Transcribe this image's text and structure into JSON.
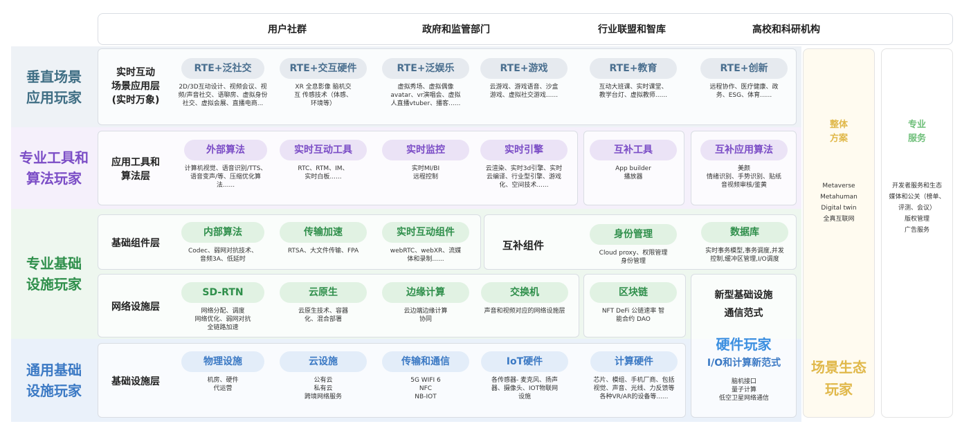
{
  "top_bar": {
    "items": [
      "用户社群",
      "政府和监管部门",
      "行业联盟和智库",
      "高校和科研机构"
    ]
  },
  "bands": [
    {
      "label": "垂直场景\n应用玩家",
      "color": "#3f6e84"
    },
    {
      "label": "专业工具和\n算法玩家",
      "color": "#7b4dc6"
    },
    {
      "label": "专业基础\n设施玩家",
      "color": "#2f8f4b"
    },
    {
      "label": "通用基础\n设施玩家",
      "color": "#3b79c4"
    }
  ],
  "layers": {
    "rte": {
      "label": "实时互动\n场景应用层\n(实时万象)",
      "cards": [
        {
          "title": "RTE+泛社交",
          "desc": "2D/3D互动设计、视频会议、视\n频/声音社交、语聊房、虚拟身份\n社交、虚拟会展、直播电商..."
        },
        {
          "title": "RTE+交互硬件",
          "desc": "XR 全息影像 脑机交\n互 传感技术（体感、\n环境等）"
        },
        {
          "title": "RTE+泛娱乐",
          "desc": "虚拟秀场、虚拟偶像\navatar、vr演唱会、虚拟\n人直播vtuber、播客......"
        },
        {
          "title": "RTE+游戏",
          "desc": "云游戏、游戏语音、沙盒\n游戏、虚拟社交游戏......"
        },
        {
          "title": "RTE+教育",
          "desc": "互动大班课、实时课堂、\n教学台灯、虚拟教师......"
        },
        {
          "title": "RTE+创新",
          "desc": "远程协作、医疗健康、政\n务、ESG、体育......"
        }
      ]
    },
    "tools": {
      "label": "应用工具和\n算法层",
      "cards": [
        {
          "title": "外部算法",
          "desc": "计算机视觉、语音识别/TTS、\n语音变声/等、压缩优化算\n法......"
        },
        {
          "title": "实时互动工具",
          "desc": "RTC、RTM、IM、\n实时白板......"
        },
        {
          "title": "实时监控",
          "desc": "实时MI/BI\n远程控制"
        },
        {
          "title": "实时引擎",
          "desc": "云渲染、实时3d引擎、实时\n云编译、行业型引擎、游戏\n化、空间技术......"
        },
        {
          "title": "互补工具",
          "desc": "App builder\n播放器"
        },
        {
          "title": "互补应用算法",
          "desc": "美颜\n情绪识别、手势识别、贴纸\n音视频审核/鉴黄"
        }
      ]
    },
    "components": {
      "label": "基础组件层",
      "cards": [
        {
          "title": "内部算法",
          "desc": "Codec、弱网对抗技术、\n音频3A、低延时"
        },
        {
          "title": "传输加速",
          "desc": "RTSA、大文件传输、FPA"
        },
        {
          "title": "实时互动组件",
          "desc": "webRTC、webXR、流媒\n体和录制......"
        }
      ],
      "complement_label": "互补组件",
      "complement_cards": [
        {
          "title": "身份管理",
          "desc": "Cloud proxy、权限管理\n身份管理"
        },
        {
          "title": "数据库",
          "desc": "实时事务模型,事务调度,并发\n控制,缓冲区管理,I/O调度"
        }
      ]
    },
    "network": {
      "label": "网络设施层",
      "cards": [
        {
          "title": "SD-RTN",
          "desc": "网络分配、调度\n网络优化、弱网对抗\n全链路加速"
        },
        {
          "title": "云原生",
          "desc": "云原生技术、容器\n化、混合部署"
        },
        {
          "title": "边缘计算",
          "desc": "云边端边缘计算\n协同"
        },
        {
          "title": "交换机",
          "desc": "声音和视频对应的网络设施层"
        },
        {
          "title": "区块链",
          "desc": "NFT DeFi 公链速率 智\n能合约 DAO"
        }
      ],
      "new_infra": "新型基础设施\n通信范式"
    },
    "infra": {
      "label": "基础设施层",
      "cards": [
        {
          "title": "物理设施",
          "desc": "机房、硬件\n代运营"
        },
        {
          "title": "云设施",
          "desc": "公有云\n私有云\n跨境网络服务"
        },
        {
          "title": "传输和通信",
          "desc": "5G WIFI 6\nNFC\nNB-IOT"
        },
        {
          "title": "IoT硬件",
          "desc": "各传感器- 麦克风、扬声\n器、摄像头、IOT物联网\n设施"
        },
        {
          "title": "计算硬件",
          "desc": "芯片、模组、手机厂商、包括\n视觉、声音、光线、力反馈等\n各种VR/AR的设备等......"
        }
      ],
      "hardware_players": "硬件玩家",
      "io": {
        "title": "I/O和计算新范式",
        "desc": "脑机接口\n量子计算\n低空卫星网络通信"
      }
    }
  },
  "side": {
    "scene": {
      "title": "整体\n方案",
      "list": "Metaverse\nMetahuman\nDigital twin\n全真互联网",
      "bottom": "场景生态\n玩家",
      "color": "#e0b84a"
    },
    "service": {
      "title": "专业\n服务",
      "list": "开发者服务和生态\n媒体和公关（榜单、\n评测、会议）\n版权管理\n广告服务",
      "color": "#6fbf7a"
    }
  }
}
